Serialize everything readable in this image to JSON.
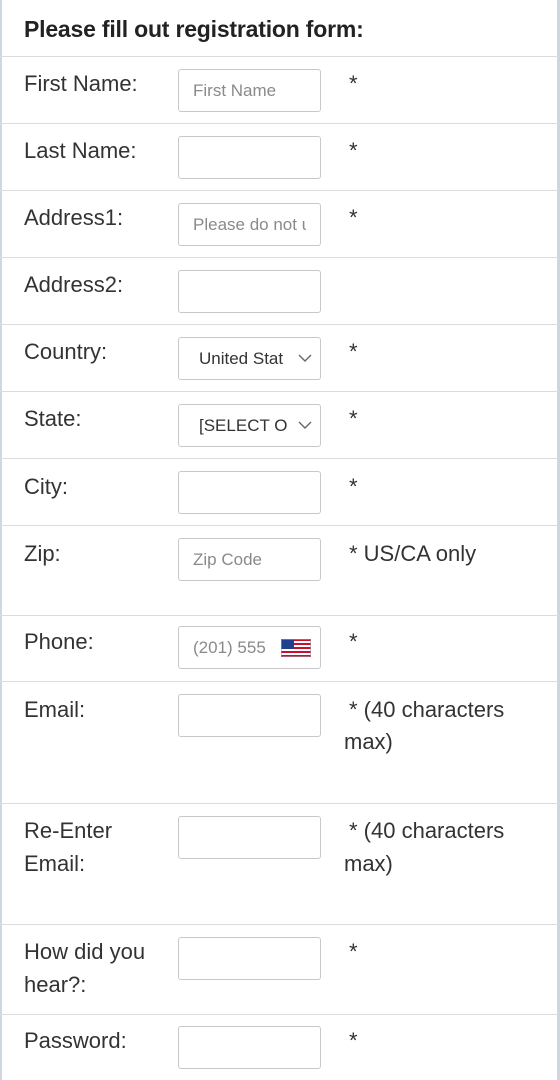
{
  "form_title": "Please fill out registration form:",
  "fields": {
    "first_name": {
      "label": "First Name:",
      "placeholder": "First Name",
      "note": "*"
    },
    "last_name": {
      "label": "Last Name:",
      "placeholder": "",
      "note": "*"
    },
    "address1": {
      "label": "Address1:",
      "placeholder": "Please do not u",
      "note": "*"
    },
    "address2": {
      "label": "Address2:",
      "placeholder": ""
    },
    "country": {
      "label": "Country:",
      "selected": "United Stat",
      "note": "*"
    },
    "state": {
      "label": "State:",
      "selected": "[SELECT OI",
      "note": "*"
    },
    "city": {
      "label": "City:",
      "placeholder": "",
      "note": "*"
    },
    "zip": {
      "label": "Zip:",
      "placeholder": "Zip Code",
      "note": "* US/CA only"
    },
    "phone": {
      "label": "Phone:",
      "placeholder": "(201) 555",
      "note": "*",
      "flag_icon": "us-flag-icon"
    },
    "email": {
      "label": "Email:",
      "placeholder": "",
      "note_line1": "* (40 characters",
      "note_line2": "max)"
    },
    "reenter_email": {
      "label_line1": "Re-Enter",
      "label_line2": "Email:",
      "placeholder": "",
      "note_line1": "* (40 characters",
      "note_line2": "max)"
    },
    "how_heard": {
      "label_line1": "How did you",
      "label_line2": "hear?:",
      "placeholder": "",
      "note": "*"
    },
    "password": {
      "label": "Password:",
      "placeholder": "",
      "note": "*"
    }
  },
  "colors": {
    "border": "#c8c8c8",
    "divider": "#dcdcdc",
    "frame": "#cfd8e1",
    "text": "#333333"
  }
}
